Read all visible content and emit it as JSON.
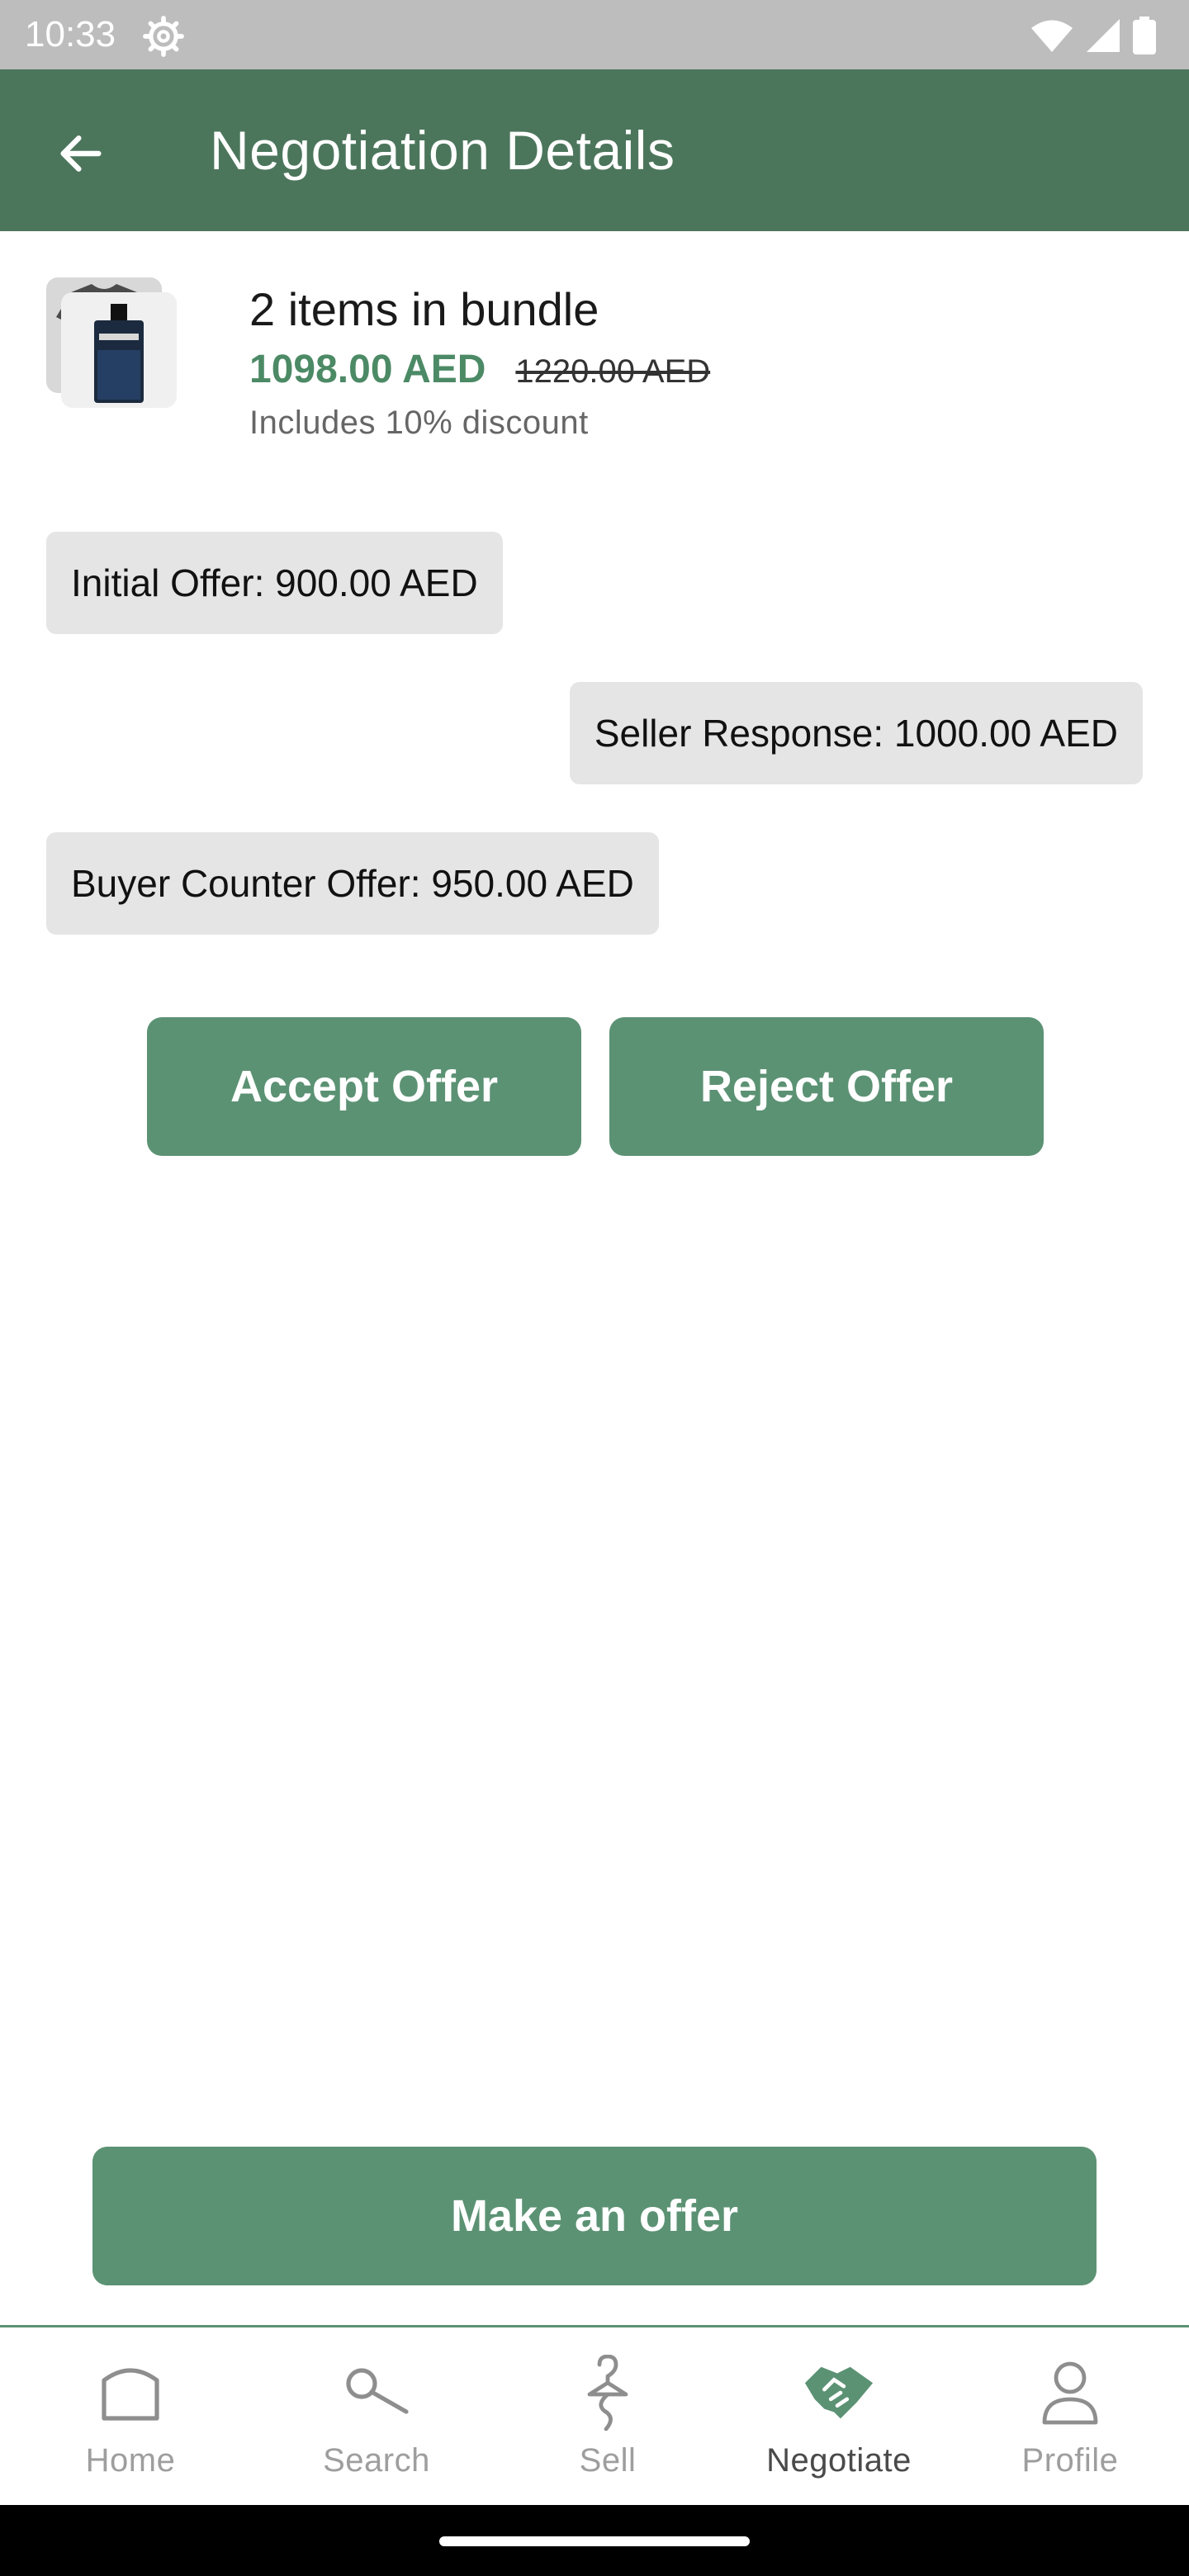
{
  "status_bar": {
    "time": "10:33"
  },
  "app_bar": {
    "title": "Negotiation Details"
  },
  "bundle": {
    "title": "2 items in bundle",
    "price": "1098.00 AED",
    "original_price": "1220.00 AED",
    "discount_note": "Includes 10% discount"
  },
  "offers": [
    {
      "label": "Initial Offer: 900.00 AED",
      "side": "buyer"
    },
    {
      "label": "Seller Response: 1000.00 AED",
      "side": "seller"
    },
    {
      "label": "Buyer Counter Offer: 950.00 AED",
      "side": "buyer"
    }
  ],
  "actions": {
    "accept_label": "Accept Offer",
    "reject_label": "Reject Offer",
    "make_offer_label": "Make an offer"
  },
  "bottom_nav": {
    "items": [
      {
        "label": "Home",
        "icon": "home-icon"
      },
      {
        "label": "Search",
        "icon": "search-icon"
      },
      {
        "label": "Sell",
        "icon": "sell-hanger-icon"
      },
      {
        "label": "Negotiate",
        "icon": "handshake-icon",
        "active": true
      },
      {
        "label": "Profile",
        "icon": "profile-icon"
      }
    ]
  },
  "colors": {
    "app_bar": "#4c765c",
    "button": "#5c9274",
    "price": "#4c8a66",
    "bubble": "#e5e5e5"
  }
}
